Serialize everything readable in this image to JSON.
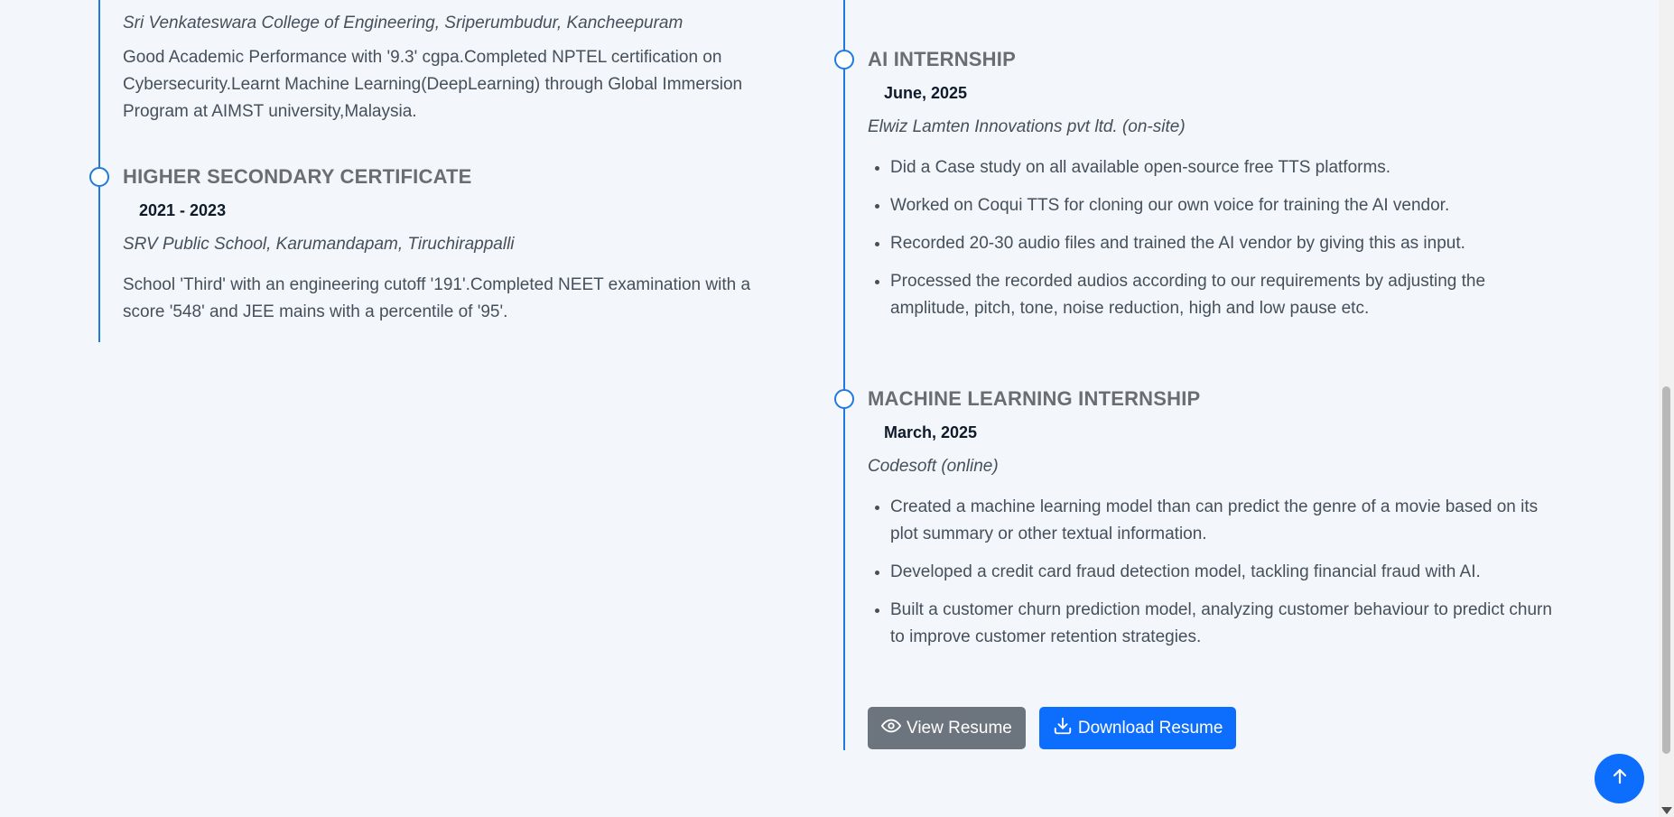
{
  "education": {
    "top_entry": {
      "institution": "Sri Venkateswara College of Engineering, Sriperumbudur, Kancheepuram",
      "description": "Good Academic Performance with '9.3' cgpa.Completed NPTEL certification on Cybersecurity.Learnt Machine Learning(DeepLearning) through Global Immersion Program at AIMST university,Malaysia."
    },
    "hsc": {
      "title": "HIGHER SECONDARY CERTIFICATE",
      "dates": "2021 - 2023",
      "institution": "SRV Public School, Karumandapam, Tiruchirappalli",
      "description": "School 'Third' with an engineering cutoff '191'.Completed NEET examination with a score '548' and JEE mains with a percentile of '95'."
    }
  },
  "experience": {
    "ai": {
      "title": "AI INTERNSHIP",
      "dates": "June, 2025",
      "org": "Elwiz Lamten Innovations pvt ltd. (on-site)",
      "bullets": [
        "Did a Case study on all available open-source free TTS platforms.",
        "Worked on Coqui TTS for cloning our own voice for training the AI vendor.",
        "Recorded 20-30 audio files and trained the AI vendor by giving this as input.",
        "Processed the recorded audios according to our requirements by adjusting the amplitude, pitch, tone, noise reduction, high and low pause etc."
      ]
    },
    "ml": {
      "title": "MACHINE LEARNING INTERNSHIP",
      "dates": "March, 2025",
      "org": "Codesoft (online)",
      "bullets": [
        "Created a machine learning model than can predict the genre of a movie based on its plot summary or other textual information.",
        "Developed a credit card fraud detection model, tackling financial fraud with AI.",
        "Built a customer churn prediction model, analyzing customer behaviour to predict churn to improve customer retention strategies."
      ]
    }
  },
  "buttons": {
    "view_resume": "View Resume",
    "download_resume": "Download Resume"
  },
  "icons": {
    "view": "eye-icon",
    "download": "download-icon",
    "scroll_top": "arrow-up-icon"
  },
  "colors": {
    "accent": "#1f7ae0",
    "primary_button": "#0d6efd",
    "secondary_button": "#6c757d",
    "background": "#f3f6fa"
  }
}
